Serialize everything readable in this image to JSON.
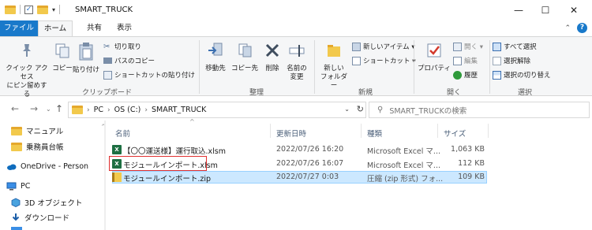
{
  "window": {
    "title": "SMART_TRUCK",
    "minimize": "—",
    "maximize": "☐",
    "close": "✕"
  },
  "ribbon_tabs": {
    "file": "ファイル",
    "home": "ホーム",
    "share": "共有",
    "view": "表示"
  },
  "ribbon": {
    "clipboard": {
      "pin_line1": "クイック アクセス",
      "pin_line2": "にピン留めする",
      "copy": "コピー",
      "paste": "貼り付け",
      "cut": "切り取り",
      "copy_path": "パスのコピー",
      "paste_shortcut": "ショートカットの貼り付け",
      "label": "クリップボード"
    },
    "organize": {
      "move_to": "移動先",
      "copy_to": "コピー先",
      "delete": "削除",
      "rename_line1": "名前の",
      "rename_line2": "変更",
      "label": "整理"
    },
    "new": {
      "new_folder_line1": "新しい",
      "new_folder_line2": "フォルダー",
      "new_item": "新しいアイテム ▾",
      "shortcut": "ショートカット ▾",
      "label": "新規"
    },
    "open": {
      "properties": "プロパティ",
      "open": "開く ▾",
      "edit": "編集",
      "history": "履歴",
      "label": "開く"
    },
    "select": {
      "select_all": "すべて選択",
      "select_none": "選択解除",
      "invert": "選択の切り替え",
      "label": "選択"
    }
  },
  "address": {
    "segments": [
      "PC",
      "OS (C:)",
      "SMART_TRUCK"
    ],
    "search_placeholder": "SMART_TRUCKの検索"
  },
  "nav_pane": {
    "items": [
      {
        "label": "マニュアル",
        "icon": "folder-icon"
      },
      {
        "label": "乗務員台帳",
        "icon": "folder-icon"
      },
      {
        "label": "OneDrive - Person",
        "icon": "cloud-icon"
      },
      {
        "label": "PC",
        "icon": "pc-icon"
      },
      {
        "label": "3D オブジェクト",
        "icon": "cube-icon"
      },
      {
        "label": "ダウンロード",
        "icon": "download-icon"
      }
    ]
  },
  "file_list": {
    "columns": {
      "name": "名前",
      "modified": "更新日時",
      "type": "種類",
      "size": "サイズ"
    },
    "rows": [
      {
        "name": "【〇〇運送様】運行取込.xlsm",
        "modified": "2022/07/26 16:20",
        "type": "Microsoft Excel マ...",
        "size": "1,063 KB",
        "icon": "excel-icon"
      },
      {
        "name": "モジュールインポート.xlsm",
        "modified": "2022/07/26 16:07",
        "type": "Microsoft Excel マ...",
        "size": "112 KB",
        "icon": "excel-icon"
      },
      {
        "name": "モジュールインポート.zip",
        "modified": "2022/07/27 0:03",
        "type": "圧縮 (zip 形式) フォ...",
        "size": "109 KB",
        "icon": "zip-icon"
      }
    ]
  },
  "colors": {
    "accent": "#1979ca",
    "selection": "#cce8ff",
    "highlight_box": "#e03030",
    "excel": "#1d6f42",
    "folder": "#f2c94c"
  }
}
